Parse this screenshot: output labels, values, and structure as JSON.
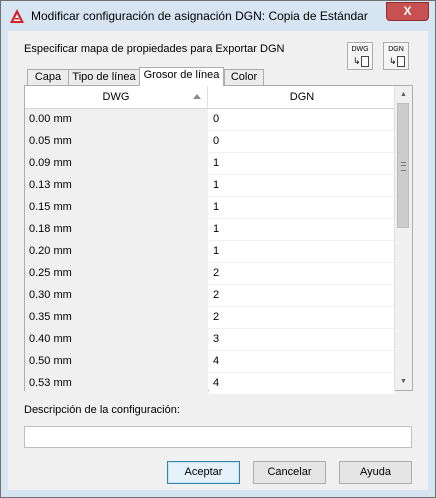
{
  "window": {
    "title": "Modificar configuración de asignación DGN: Copia de Estándar",
    "close_label": "X"
  },
  "section_label": "Especificar mapa de propiedades para Exportar DGN",
  "toolbar": {
    "dwg_label": "DWG",
    "dgn_label": "DGN"
  },
  "tabs": [
    {
      "label": "Capa",
      "active": false
    },
    {
      "label": "Tipo de línea",
      "active": false
    },
    {
      "label": "Grosor de línea",
      "active": true
    },
    {
      "label": "Color",
      "active": false
    }
  ],
  "grid": {
    "columns": {
      "dwg": "DWG",
      "dgn": "DGN"
    },
    "rows": [
      {
        "dwg": "0.00 mm",
        "dgn": "0"
      },
      {
        "dwg": "0.05 mm",
        "dgn": "0"
      },
      {
        "dwg": "0.09 mm",
        "dgn": "1"
      },
      {
        "dwg": "0.13 mm",
        "dgn": "1"
      },
      {
        "dwg": "0.15 mm",
        "dgn": "1"
      },
      {
        "dwg": "0.18 mm",
        "dgn": "1"
      },
      {
        "dwg": "0.20 mm",
        "dgn": "1"
      },
      {
        "dwg": "0.25 mm",
        "dgn": "2"
      },
      {
        "dwg": "0.30 mm",
        "dgn": "2"
      },
      {
        "dwg": "0.35 mm",
        "dgn": "2"
      },
      {
        "dwg": "0.40 mm",
        "dgn": "3"
      },
      {
        "dwg": "0.50 mm",
        "dgn": "4"
      },
      {
        "dwg": "0.53 mm",
        "dgn": "4"
      }
    ]
  },
  "description": {
    "label": "Descripción de la configuración:",
    "value": ""
  },
  "buttons": {
    "ok": "Aceptar",
    "cancel": "Cancelar",
    "help": "Ayuda"
  },
  "colors": {
    "titlebar": "#d7e4f2",
    "close": "#c75050",
    "autocad_red": "#d2232a"
  }
}
